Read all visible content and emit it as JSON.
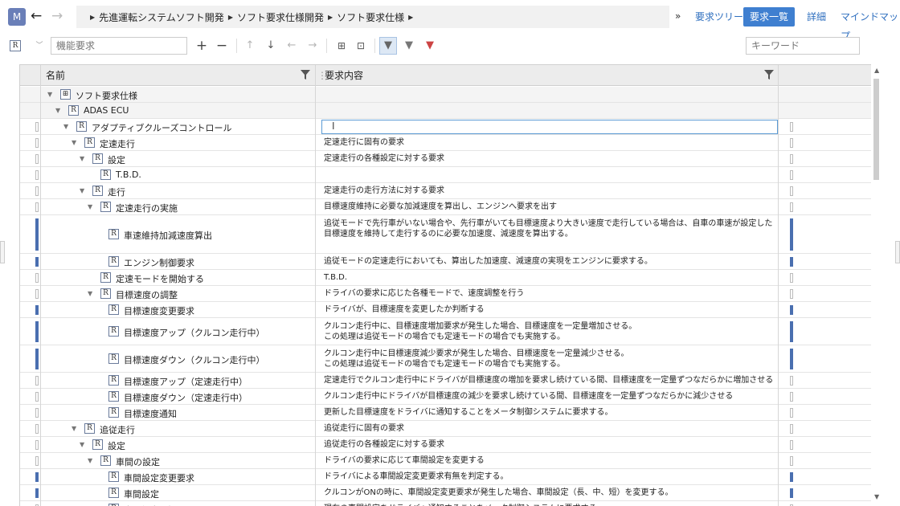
{
  "app": {
    "avatar": "M"
  },
  "nav": {
    "back": "←",
    "forward": "→"
  },
  "breadcrumb": [
    "先進運転システムソフト開発",
    "ソフト要求仕様開発",
    "ソフト要求仕様"
  ],
  "more": "»",
  "views": {
    "tree": "要求ツリー",
    "list": "要求一覧",
    "detail": "詳細",
    "mindmap": "マインドマップ"
  },
  "toolbar": {
    "filter_placeholder": "機能要求",
    "keyword_placeholder": "キーワード"
  },
  "columns": {
    "name": "名前",
    "content": "要求内容"
  },
  "colors": {
    "accent": "#3f7fd0",
    "marker": "#4a6fb0"
  },
  "rows": [
    {
      "name": "ソフト要求仕様",
      "desc": ""
    },
    {
      "name": "ADAS ECU",
      "desc": ""
    },
    {
      "name": "アダプティブクルーズコントロール",
      "desc": ""
    },
    {
      "name": "定速走行",
      "desc": "定速走行に固有の要求"
    },
    {
      "name": "設定",
      "desc": "定速走行の各種設定に対する要求"
    },
    {
      "name": "T.B.D.",
      "desc": ""
    },
    {
      "name": "走行",
      "desc": "定速走行の走行方法に対する要求"
    },
    {
      "name": "定速走行の実施",
      "desc": "目標速度維持に必要な加減速度を算出し、エンジンへ要求を出す"
    },
    {
      "name": "車速維持加減速度算出",
      "desc": "追従モードで先行車がいない場合や、先行車がいても目標速度より大きい速度で走行している場合は、自車の車速が設定した目標速度を維持して走行するのに必要な加速度、減速度を算出する。"
    },
    {
      "name": "エンジン制御要求",
      "desc": "追従モードの定速走行においても、算出した加速度、減速度の実現をエンジンに要求する。"
    },
    {
      "name": "定速モードを開始する",
      "desc": "T.B.D."
    },
    {
      "name": "目標速度の調整",
      "desc": "ドライバの要求に応じた各種モードで、速度調整を行う"
    },
    {
      "name": "目標速度変更要求",
      "desc": "ドライバが、目標速度を変更したか判断する"
    },
    {
      "name": "目標速度アップ（クルコン走行中）",
      "desc": "クルコン走行中に、目標速度増加要求が発生した場合、目標速度を一定量増加させる。\nこの処理は追従モードの場合でも定速モードの場合でも実施する。"
    },
    {
      "name": "目標速度ダウン（クルコン走行中）",
      "desc": "クルコン走行中に目標速度減少要求が発生した場合、目標速度を一定量減少させる。\nこの処理は追従モードの場合でも定速モードの場合でも実施する。"
    },
    {
      "name": "目標速度アップ（定速走行中）",
      "desc": "定速走行でクルコン走行中にドライバが目標速度の増加を要求し続けている間、目標速度を一定量ずつなだらかに増加させる"
    },
    {
      "name": "目標速度ダウン（定速走行中）",
      "desc": "クルコン走行中にドライバが目標速度の減少を要求し続けている間、目標速度を一定量ずつなだらかに減少させる"
    },
    {
      "name": "目標速度通知",
      "desc": "更新した目標速度をドライバに通知することをメータ制御システムに要求する。"
    },
    {
      "name": "追従走行",
      "desc": "追従走行に固有の要求"
    },
    {
      "name": "設定",
      "desc": "追従走行の各種設定に対する要求"
    },
    {
      "name": "車間の設定",
      "desc": "ドライバの要求に応じて車間設定を変更する"
    },
    {
      "name": "車間設定変更要求",
      "desc": "ドライバによる車間設定変更要求有無を判定する。"
    },
    {
      "name": "車間設定",
      "desc": "クルコンがONの時に、車間設定変更要求が発生した場合、車間設定（長、中、短）を変更する。"
    },
    {
      "name": "車間設定通知",
      "desc": "現在の車間設定をドライバへ通知することをメータ制御システムに要求する。"
    }
  ]
}
